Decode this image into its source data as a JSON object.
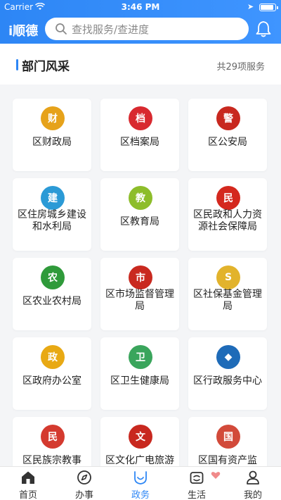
{
  "status": {
    "carrier": "Carrier",
    "time": "3:46 PM"
  },
  "header": {
    "logo": "i顺德",
    "search_placeholder": "查找服务/查进度"
  },
  "section": {
    "title": "部门风采",
    "count": "共29项服务"
  },
  "departments": [
    {
      "label": "区财政局",
      "emblem": "财",
      "color": "#e6a21a"
    },
    {
      "label": "区档案局",
      "emblem": "档",
      "color": "#d8292f"
    },
    {
      "label": "区公安局",
      "emblem": "警",
      "color": "#c8281f"
    },
    {
      "label": "区住房城乡建设和水利局",
      "emblem": "建",
      "color": "#2b9ad6"
    },
    {
      "label": "区教育局",
      "emblem": "教",
      "color": "#8dbd2a"
    },
    {
      "label": "区民政和人力资源社会保障局",
      "emblem": "民",
      "color": "#d4281e"
    },
    {
      "label": "区农业农村局",
      "emblem": "农",
      "color": "#2f9a3a"
    },
    {
      "label": "区市场监督管理局",
      "emblem": "市",
      "color": "#c9291f"
    },
    {
      "label": "区社保基金管理局",
      "emblem": "S",
      "color": "#e2b32c"
    },
    {
      "label": "区政府办公室",
      "emblem": "政",
      "color": "#e8a914"
    },
    {
      "label": "区卫生健康局",
      "emblem": "卫",
      "color": "#3aa55c"
    },
    {
      "label": "区行政服务中心",
      "emblem": "◆",
      "color": "#1e6bb8"
    },
    {
      "label": "区民族宗教事",
      "emblem": "民",
      "color": "#d43a2f"
    },
    {
      "label": "区文化广电旅游",
      "emblem": "文",
      "color": "#c8281f"
    },
    {
      "label": "区国有资产监",
      "emblem": "国",
      "color": "#d24a3a"
    }
  ],
  "tabs": [
    {
      "label": "首页",
      "icon": "home-icon"
    },
    {
      "label": "办事",
      "icon": "compass-icon"
    },
    {
      "label": "政务",
      "icon": "government-icon"
    },
    {
      "label": "生活",
      "icon": "life-icon"
    },
    {
      "label": "我的",
      "icon": "profile-icon"
    }
  ],
  "colors": {
    "primary": "#2d86f5",
    "background": "#f4f5f7"
  }
}
